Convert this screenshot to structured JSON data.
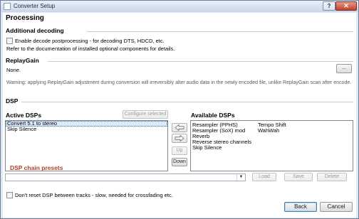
{
  "window": {
    "title": "Converter Setup",
    "help": "?",
    "close": "✕"
  },
  "page_title": "Processing",
  "additional_decoding": {
    "heading": "Additional decoding",
    "checkbox_label": "Enable decode postprocessing - for decoding DTS, HDCD, etc.",
    "note": "Refer to the documentation of installed optional components for details."
  },
  "replaygain": {
    "heading": "ReplayGain",
    "value": "None.",
    "browse_button": "...",
    "warning": "Warning: applying ReplayGain adjustment during conversion will irreversibly alter audio data in the newly encoded file, unlike ReplayGain scan after encode."
  },
  "dsp": {
    "heading": "DSP",
    "active_heading": "Active DSPs",
    "configure_button": "Configure selected",
    "active_items": [
      "Convert 5.1 to stereo",
      "Skip Silence"
    ],
    "available_heading": "Available DSPs",
    "available_col1": [
      "Resampler (PPHS)",
      "Resampler (SoX) mod",
      "Reverb",
      "Reverse stereo channels",
      "Skip Silence"
    ],
    "available_col2": [
      "Tempo Shift",
      "WahWah"
    ],
    "add_arrow": "left-arrow-icon",
    "remove_arrow": "right-arrow-icon",
    "up_button": "Up",
    "down_button": "Down"
  },
  "presets": {
    "heading": "DSP chain presets",
    "heading_color": "#b5411f",
    "load_button": "Load",
    "save_button": "Save",
    "delete_button": "Delete"
  },
  "dont_reset": {
    "label": "Don't reset DSP between tracks - slow, needed for crossfading etc."
  },
  "footer": {
    "back_button": "Back",
    "cancel_button": "Cancel"
  }
}
